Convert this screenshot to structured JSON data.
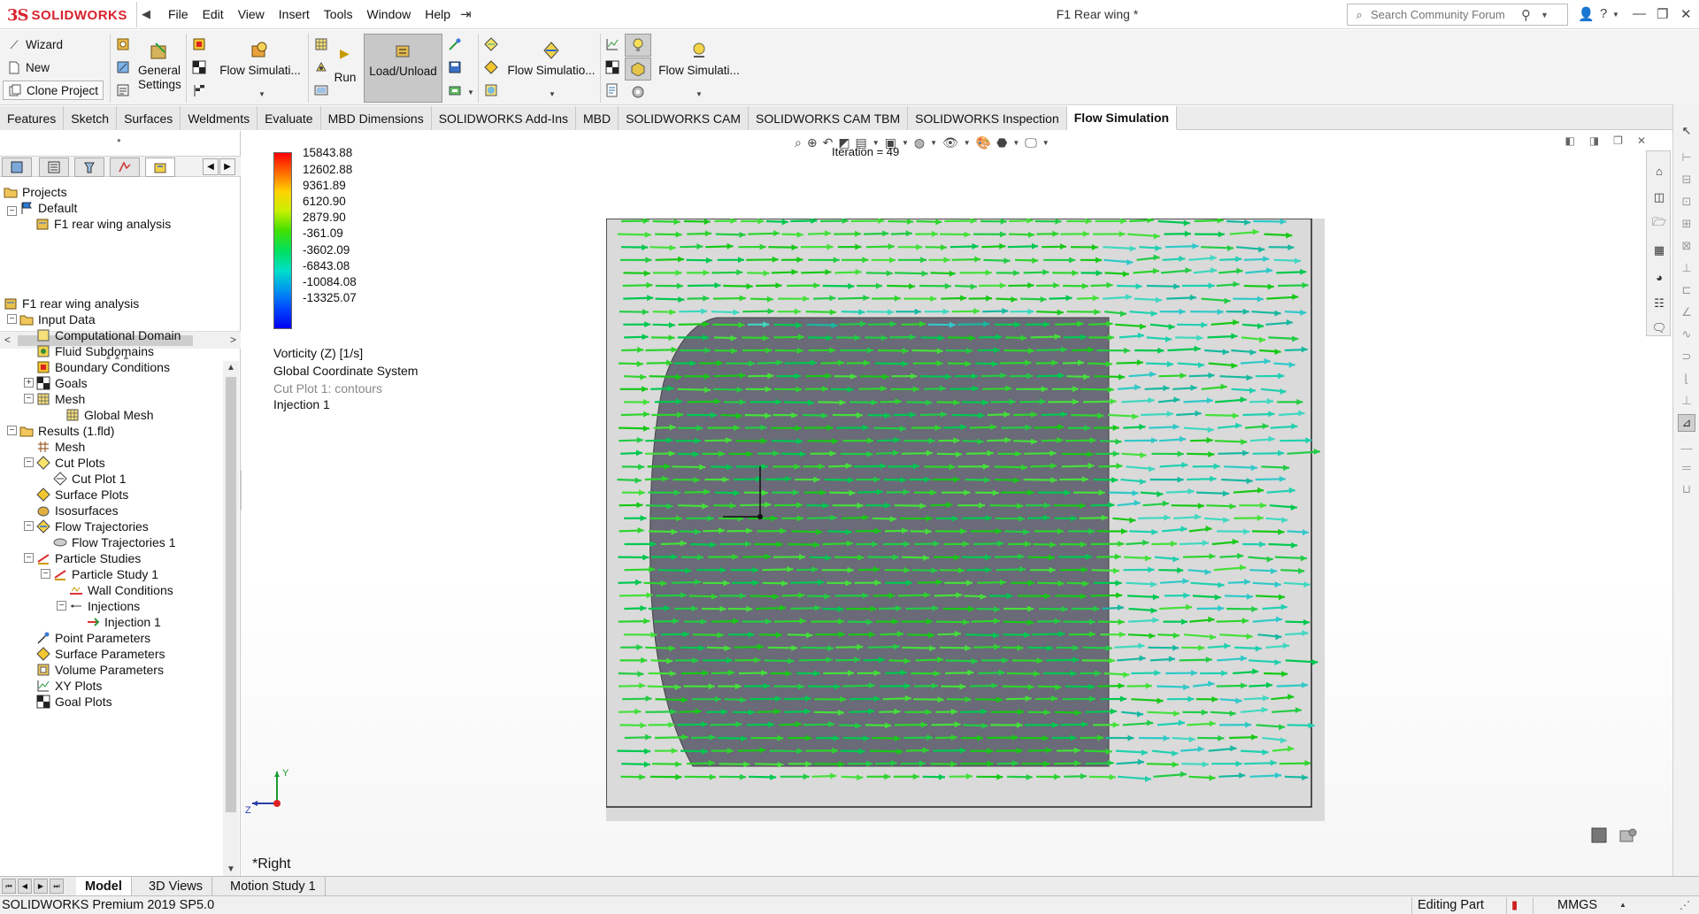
{
  "app": {
    "logo_ds": "3S",
    "logo_text": "SOLIDWORKS",
    "document_title": "F1 Rear wing *",
    "menu": [
      "File",
      "Edit",
      "View",
      "Insert",
      "Tools",
      "Window",
      "Help"
    ],
    "search_placeholder": "Search Community Forum"
  },
  "toolbar": {
    "wizard": "Wizard",
    "new": "New",
    "clone_project": "Clone Project",
    "general": "General",
    "settings": "Settings",
    "flow_sim_1": "Flow Simulati...",
    "run": "Run",
    "load_unload": "Load/Unload",
    "flow_sim_2": "Flow Simulatio...",
    "flow_sim_3": "Flow Simulati..."
  },
  "tabs": [
    {
      "label": "Features"
    },
    {
      "label": "Sketch"
    },
    {
      "label": "Surfaces"
    },
    {
      "label": "Weldments"
    },
    {
      "label": "Evaluate"
    },
    {
      "label": "MBD Dimensions"
    },
    {
      "label": "SOLIDWORKS Add-Ins"
    },
    {
      "label": "MBD"
    },
    {
      "label": "SOLIDWORKS CAM"
    },
    {
      "label": "SOLIDWORKS CAM TBM"
    },
    {
      "label": "SOLIDWORKS Inspection"
    },
    {
      "label": "Flow Simulation"
    }
  ],
  "projects_tree": {
    "root": "Projects",
    "config": "Default",
    "project": "F1 rear wing analysis"
  },
  "analysis_tree": {
    "root": "F1 rear wing analysis",
    "input_data": "Input Data",
    "computational_domain": "Computational Domain",
    "fluid_subdomains": "Fluid Subdomains",
    "boundary_conditions": "Boundary Conditions",
    "goals": "Goals",
    "mesh": "Mesh",
    "global_mesh": "Global Mesh",
    "results": "Results (1.fld)",
    "results_mesh": "Mesh",
    "cut_plots": "Cut Plots",
    "cut_plot_1": "Cut Plot 1",
    "surface_plots": "Surface Plots",
    "isosurfaces": "Isosurfaces",
    "flow_trajectories": "Flow Trajectories",
    "flow_trajectories_1": "Flow Trajectories 1",
    "particle_studies": "Particle Studies",
    "particle_study_1": "Particle Study 1",
    "wall_conditions": "Wall Conditions",
    "injections": "Injections",
    "injection_1": "Injection 1",
    "point_parameters": "Point Parameters",
    "surface_parameters": "Surface Parameters",
    "volume_parameters": "Volume Parameters",
    "xy_plots": "XY Plots",
    "goal_plots": "Goal Plots"
  },
  "viewport": {
    "iteration": "Iteration = 49",
    "legend_values": [
      "15843.88",
      "12602.88",
      "9361.89",
      "6120.90",
      "2879.90",
      "-361.09",
      "-3602.09",
      "-6843.08",
      "-10084.08",
      "-13325.07"
    ],
    "legend_colors": [
      "#ff0000",
      "#ff6a00",
      "#ffd200",
      "#c8f000",
      "#44e000",
      "#00e060",
      "#00e0c8",
      "#0096f0",
      "#0046ff",
      "#0000f0"
    ],
    "legend_title": "Vorticity (Z) [1/s]",
    "coordinate_system": "Global Coordinate System",
    "cut_plot_info": "Cut Plot 1: contours",
    "injection_info": "Injection 1",
    "view_name": "*Right",
    "triad_y": "Y",
    "triad_z": "Z"
  },
  "bottom_tabs": [
    "Model",
    "3D Views",
    "Motion Study 1"
  ],
  "status": {
    "product": "SOLIDWORKS Premium 2019 SP5.0",
    "mode": "Editing Part",
    "units": "MMGS"
  }
}
